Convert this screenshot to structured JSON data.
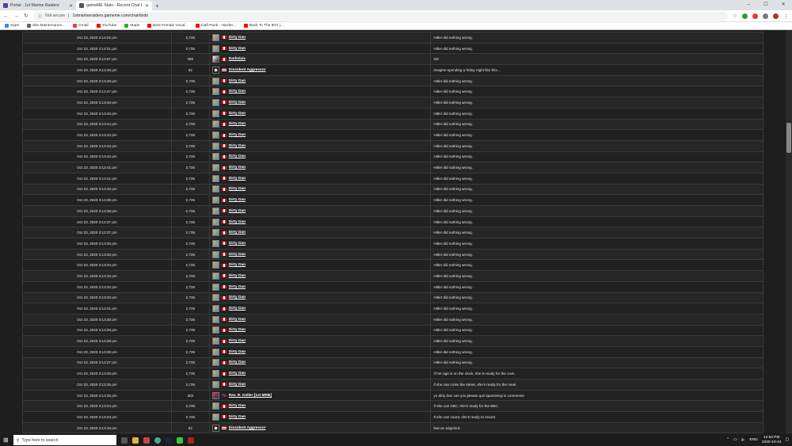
{
  "browser": {
    "tabs": [
      {
        "title": "Portal - 1st Marine Raiders",
        "active": false
      },
      {
        "title": "gameME Stats - Recent Chat Log",
        "active": true
      }
    ],
    "new_tab": "+",
    "window_controls": [
      "–",
      "☐",
      "✕"
    ],
    "address": {
      "security": "Not secure",
      "url": "1stmarineraiders.gameme.com/chat/dods"
    },
    "bookmarks": [
      "Apps",
      "Site Maintenance...",
      "Gmail",
      "YouTube",
      "Maps",
      "Best Female Vocal...",
      "Daft Punk - Harder...",
      "Back To The 80's |..."
    ]
  },
  "chat_rows": [
    {
      "time": "Oct 23, 2020 3:14:02 pm",
      "score": "2,735",
      "user": "Dirty Dan",
      "avatar": "map",
      "flag": "ca",
      "msg": "Hitler did nothing wrong."
    },
    {
      "time": "Oct 23, 2020 3:14:01 pm",
      "score": "2,735",
      "user": "Dirty Dan",
      "avatar": "map",
      "flag": "ca",
      "msg": "Hitler did nothing wrong."
    },
    {
      "time": "Oct 23, 2020 3:13:57 pm",
      "score": "398",
      "user": "Darkslaix",
      "avatar": "dark",
      "flag": "ca",
      "msg": "XD"
    },
    {
      "time": "Oct 23, 2020 3:13:49 pm",
      "score": "62",
      "user": "Dissident Aggressor",
      "avatar": "skull",
      "flag": "us",
      "msg": "imagine spending a friday night like this..."
    },
    {
      "time": "Oct 23, 2020 3:13:48 pm",
      "score": "2,735",
      "user": "Dirty Dan",
      "avatar": "map",
      "flag": "ca",
      "msg": "Hitler did nothing wrong."
    },
    {
      "time": "Oct 23, 2020 3:13:47 pm",
      "score": "2,735",
      "user": "Dirty Dan",
      "avatar": "map",
      "flag": "ca",
      "msg": "Hitler did nothing wrong."
    },
    {
      "time": "Oct 23, 2020 3:13:46 pm",
      "score": "2,735",
      "user": "Dirty Dan",
      "avatar": "map",
      "flag": "ca",
      "msg": "Hitler did nothing wrong."
    },
    {
      "time": "Oct 23, 2020 3:13:45 pm",
      "score": "2,735",
      "user": "Dirty Dan",
      "avatar": "map",
      "flag": "ca",
      "msg": "Hitler did nothing wrong."
    },
    {
      "time": "Oct 23, 2020 3:13:44 pm",
      "score": "2,735",
      "user": "Dirty Dan",
      "avatar": "map",
      "flag": "ca",
      "msg": "Hitler did nothing wrong."
    },
    {
      "time": "Oct 23, 2020 3:13:44 pm",
      "score": "2,735",
      "user": "Dirty Dan",
      "avatar": "map",
      "flag": "ca",
      "msg": "Hitler did nothing wrong."
    },
    {
      "time": "Oct 23, 2020 3:13:43 pm",
      "score": "2,735",
      "user": "Dirty Dan",
      "avatar": "map",
      "flag": "ca",
      "msg": "Hitler did nothing wrong."
    },
    {
      "time": "Oct 23, 2020 3:13:42 pm",
      "score": "2,735",
      "user": "Dirty Dan",
      "avatar": "map",
      "flag": "ca",
      "msg": "Hitler did nothing wrong."
    },
    {
      "time": "Oct 23, 2020 3:13:41 pm",
      "score": "2,735",
      "user": "Dirty Dan",
      "avatar": "map",
      "flag": "ca",
      "msg": "Hitler did nothing wrong."
    },
    {
      "time": "Oct 23, 2020 3:13:41 pm",
      "score": "2,735",
      "user": "Dirty Dan",
      "avatar": "map",
      "flag": "ca",
      "msg": "Hitler did nothing wrong."
    },
    {
      "time": "Oct 23, 2020 3:13:40 pm",
      "score": "2,735",
      "user": "Dirty Dan",
      "avatar": "map",
      "flag": "ca",
      "msg": "Hitler did nothing wrong."
    },
    {
      "time": "Oct 23, 2020 3:13:39 pm",
      "score": "2,735",
      "user": "Dirty Dan",
      "avatar": "map",
      "flag": "ca",
      "msg": "Hitler did nothing wrong."
    },
    {
      "time": "Oct 23, 2020 3:13:38 pm",
      "score": "2,735",
      "user": "Dirty Dan",
      "avatar": "map",
      "flag": "ca",
      "msg": "Hitler did nothing wrong."
    },
    {
      "time": "Oct 23, 2020 3:13:37 pm",
      "score": "2,735",
      "user": "Dirty Dan",
      "avatar": "map",
      "flag": "ca",
      "msg": "Hitler did nothing wrong."
    },
    {
      "time": "Oct 23, 2020 3:13:37 pm",
      "score": "2,735",
      "user": "Dirty Dan",
      "avatar": "map",
      "flag": "ca",
      "msg": "Hitler did nothing wrong."
    },
    {
      "time": "Oct 23, 2020 3:13:36 pm",
      "score": "2,735",
      "user": "Dirty Dan",
      "avatar": "map",
      "flag": "ca",
      "msg": "Hitler did nothing wrong."
    },
    {
      "time": "Oct 23, 2020 3:13:35 pm",
      "score": "2,735",
      "user": "Dirty Dan",
      "avatar": "map",
      "flag": "ca",
      "msg": "Hitler did nothing wrong."
    },
    {
      "time": "Oct 23, 2020 3:13:34 pm",
      "score": "2,735",
      "user": "Dirty Dan",
      "avatar": "map",
      "flag": "ca",
      "msg": "Hitler did nothing wrong."
    },
    {
      "time": "Oct 23, 2020 3:13:33 pm",
      "score": "2,735",
      "user": "Dirty Dan",
      "avatar": "map",
      "flag": "ca",
      "msg": "Hitler did nothing wrong."
    },
    {
      "time": "Oct 23, 2020 3:13:32 pm",
      "score": "2,735",
      "user": "Dirty Dan",
      "avatar": "map",
      "flag": "ca",
      "msg": "Hitler did nothing wrong."
    },
    {
      "time": "Oct 23, 2020 3:13:32 pm",
      "score": "2,735",
      "user": "Dirty Dan",
      "avatar": "map",
      "flag": "ca",
      "msg": "Hitler did nothing wrong."
    },
    {
      "time": "Oct 23, 2020 3:13:31 pm",
      "score": "2,735",
      "user": "Dirty Dan",
      "avatar": "map",
      "flag": "ca",
      "msg": "Hitler did nothing wrong."
    },
    {
      "time": "Oct 23, 2020 3:13:30 pm",
      "score": "2,735",
      "user": "Dirty Dan",
      "avatar": "map",
      "flag": "ca",
      "msg": "Hitler did nothing wrong."
    },
    {
      "time": "Oct 23, 2020 3:13:29 pm",
      "score": "2,735",
      "user": "Dirty Dan",
      "avatar": "map",
      "flag": "ca",
      "msg": "Hitler did nothing wrong."
    },
    {
      "time": "Oct 23, 2020 3:13:28 pm",
      "score": "2,735",
      "user": "Dirty Dan",
      "avatar": "map",
      "flag": "ca",
      "msg": "Hitler did nothing wrong."
    },
    {
      "time": "Oct 23, 2020 3:13:28 pm",
      "score": "2,735",
      "user": "Dirty Dan",
      "avatar": "map",
      "flag": "ca",
      "msg": "Hitler did nothing wrong."
    },
    {
      "time": "Oct 23, 2020 3:13:27 pm",
      "score": "2,735",
      "user": "Dirty Dan",
      "avatar": "map",
      "flag": "ca",
      "msg": "Hitler did nothing wrong."
    },
    {
      "time": "Oct 23, 2020 3:13:26 pm",
      "score": "2,735",
      "user": "Dirty Dan",
      "avatar": "map",
      "flag": "ca",
      "msg": "If her age is on the clock, she is ready for the cock."
    },
    {
      "time": "Oct 23, 2020 3:13:25 pm",
      "score": "2,735",
      "user": "Dirty Dan",
      "avatar": "map",
      "flag": "ca",
      "msg": "if she can cross the street, she's ready for the meat"
    },
    {
      "time": "Oct 23, 2020 3:13:25 pm",
      "score": "303",
      "user": "Rev. R. Keller [1st MRB]",
      "avatar": "flag",
      "flag": "gb",
      "msg": "yo dirty dan can you please quit spamming in comments"
    },
    {
      "time": "Oct 23, 2020 3:13:24 pm",
      "score": "2,735",
      "user": "Dirty Dan",
      "avatar": "map",
      "flag": "ca",
      "msg": "If she can ABC, she's ready for the BBC."
    },
    {
      "time": "Oct 23, 2020 3:13:23 pm",
      "score": "2,735",
      "user": "Dirty Dan",
      "avatar": "map",
      "flag": "ca",
      "msg": "If she can count, she's ready to mount."
    },
    {
      "time": "Oct 23, 2020 3:13:16 pm",
      "score": "62",
      "user": "Dissident Aggressor",
      "avatar": "skull",
      "flag": "us",
      "msg": "has an edgelord."
    }
  ],
  "taskbar": {
    "search_placeholder": "Type here to search",
    "lang": "ENG",
    "time": "12:53 PM",
    "date": "2020-10-24"
  }
}
